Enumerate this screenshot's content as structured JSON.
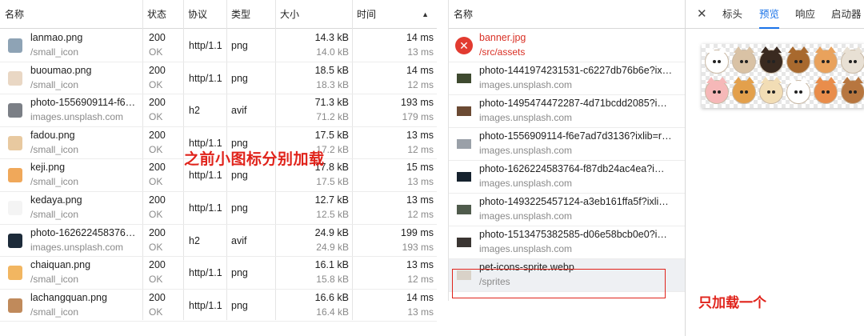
{
  "left_table": {
    "headers": {
      "name": "名称",
      "status": "状态",
      "protocol": "协议",
      "type": "类型",
      "size": "大小",
      "time": "时间",
      "sort_indicator": "▲"
    },
    "rows": [
      {
        "name": "lanmao.png",
        "path": "/small_icon",
        "status": "200",
        "status_text": "OK",
        "protocol": "http/1.1",
        "type": "png",
        "size_transferred": "14.3 kB",
        "size_resource": "14.0 kB",
        "time": "14 ms",
        "latency": "13 ms",
        "thumb_color": "#8ea3b5"
      },
      {
        "name": "buoumao.png",
        "path": "/small_icon",
        "status": "200",
        "status_text": "OK",
        "protocol": "http/1.1",
        "type": "png",
        "size_transferred": "18.5 kB",
        "size_resource": "18.3 kB",
        "time": "14 ms",
        "latency": "12 ms",
        "thumb_color": "#e9d7c4"
      },
      {
        "name": "photo-1556909114-f6…",
        "path": "images.unsplash.com",
        "status": "200",
        "status_text": "OK",
        "protocol": "h2",
        "type": "avif",
        "size_transferred": "71.3 kB",
        "size_resource": "71.2 kB",
        "time": "193 ms",
        "latency": "179 ms",
        "thumb_color": "#7b7f86"
      },
      {
        "name": "fadou.png",
        "path": "/small_icon",
        "status": "200",
        "status_text": "OK",
        "protocol": "http/1.1",
        "type": "png",
        "size_transferred": "17.5 kB",
        "size_resource": "17.2 kB",
        "time": "13 ms",
        "latency": "12 ms",
        "thumb_color": "#e8c9a0"
      },
      {
        "name": "keji.png",
        "path": "/small_icon",
        "status": "200",
        "status_text": "OK",
        "protocol": "http/1.1",
        "type": "png",
        "size_transferred": "17.8 kB",
        "size_resource": "17.5 kB",
        "time": "15 ms",
        "latency": "13 ms",
        "thumb_color": "#f0a85a"
      },
      {
        "name": "kedaya.png",
        "path": "/small_icon",
        "status": "200",
        "status_text": "OK",
        "protocol": "http/1.1",
        "type": "png",
        "size_transferred": "12.7 kB",
        "size_resource": "12.5 kB",
        "time": "13 ms",
        "latency": "12 ms",
        "thumb_color": "#f4f4f4"
      },
      {
        "name": "photo-162622458376…",
        "path": "images.unsplash.com",
        "status": "200",
        "status_text": "OK",
        "protocol": "h2",
        "type": "avif",
        "size_transferred": "24.9 kB",
        "size_resource": "24.9 kB",
        "time": "199 ms",
        "latency": "193 ms",
        "thumb_color": "#1d2b3a"
      },
      {
        "name": "chaiquan.png",
        "path": "/small_icon",
        "status": "200",
        "status_text": "OK",
        "protocol": "http/1.1",
        "type": "png",
        "size_transferred": "16.1 kB",
        "size_resource": "15.8 kB",
        "time": "13 ms",
        "latency": "12 ms",
        "thumb_color": "#f2b661"
      },
      {
        "name": "lachangquan.png",
        "path": "/small_icon",
        "status": "200",
        "status_text": "OK",
        "protocol": "http/1.1",
        "type": "png",
        "size_transferred": "16.6 kB",
        "size_resource": "16.4 kB",
        "time": "14 ms",
        "latency": "13 ms",
        "thumb_color": "#c08a5b"
      }
    ],
    "annotation": "之前小图标分别加载"
  },
  "request_list": {
    "header": "名称",
    "rows": [
      {
        "name": "banner.jpg",
        "path": "/src/assets",
        "error": true,
        "thumb_color": "#e23b30"
      },
      {
        "name": "photo-1441974231531-c6227db76b6e?ix…",
        "path": "images.unsplash.com",
        "error": false,
        "thumb_color": "#3e4a2f"
      },
      {
        "name": "photo-1495474472287-4d71bcdd2085?i…",
        "path": "images.unsplash.com",
        "error": false,
        "thumb_color": "#6b4a33"
      },
      {
        "name": "photo-1556909114-f6e7ad7d3136?ixlib=r…",
        "path": "images.unsplash.com",
        "error": false,
        "thumb_color": "#9aa0a8"
      },
      {
        "name": "photo-1626224583764-f87db24ac4ea?i…",
        "path": "images.unsplash.com",
        "error": false,
        "thumb_color": "#16222e"
      },
      {
        "name": "photo-1493225457124-a3eb161ffa5f?ixli…",
        "path": "images.unsplash.com",
        "error": false,
        "thumb_color": "#4f5b4c"
      },
      {
        "name": "photo-1513475382585-d06e58bcb0e0?i…",
        "path": "images.unsplash.com",
        "error": false,
        "thumb_color": "#3a3532"
      },
      {
        "name": "pet-icons-sprite.webp",
        "path": "/sprites",
        "error": false,
        "selected": true,
        "thumb_color": "#d9d2c8"
      }
    ]
  },
  "preview_panel": {
    "close_glyph": "✕",
    "tabs": [
      "标头",
      "预览",
      "响应",
      "启动器"
    ],
    "active_tab": "预览",
    "active_color": "#1a73e8",
    "pets_row1": [
      "#ffffff",
      "#d9c2a5",
      "#3a2a20",
      "#a8692e",
      "#e9a25c",
      "#e8e0d4"
    ],
    "pets_row2": [
      "#f6b8b8",
      "#e3a04c",
      "#f2ddb5",
      "#ffffff",
      "#e98d4b",
      "#b7763f"
    ]
  },
  "annotation_right": "只加载一个",
  "accent_color": "#e0231b"
}
